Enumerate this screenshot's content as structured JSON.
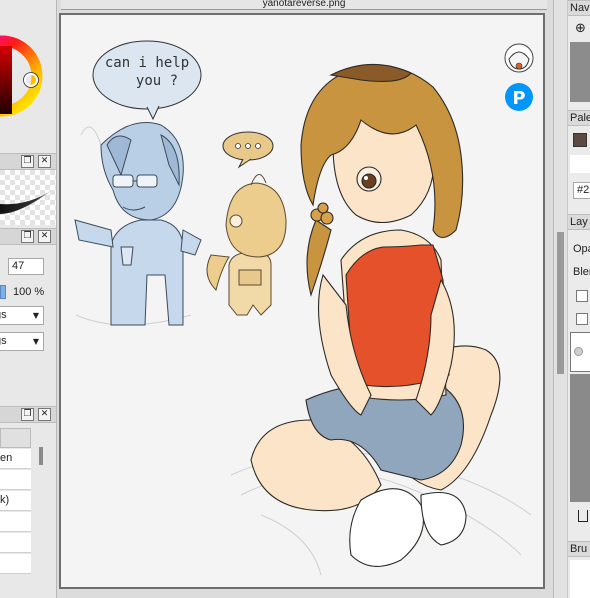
{
  "canvas": {
    "title": "yanotareverse.png"
  },
  "left_panel": {
    "brush_size_value": "47",
    "opacity_value": "100 %",
    "dropdown1_value": "gs",
    "dropdown2_value": "gs",
    "list_items": [
      "en",
      "",
      "k)",
      "",
      "",
      ""
    ]
  },
  "right_panel": {
    "navigator_label": "Nav",
    "palette_label": "Pale",
    "hex_value": "#2",
    "layers_label": "Lay",
    "opacity_label": "Opa",
    "blend_label": "Blen",
    "brush_label": "Bru"
  },
  "artwork": {
    "speech_bubble_line1": "can i help",
    "speech_bubble_line2": "you ?"
  },
  "colors": {
    "palette_swatch": "#5b4a3f",
    "canvas_border": "#6e6e6e",
    "pixiv_blue": "#0096fa"
  }
}
